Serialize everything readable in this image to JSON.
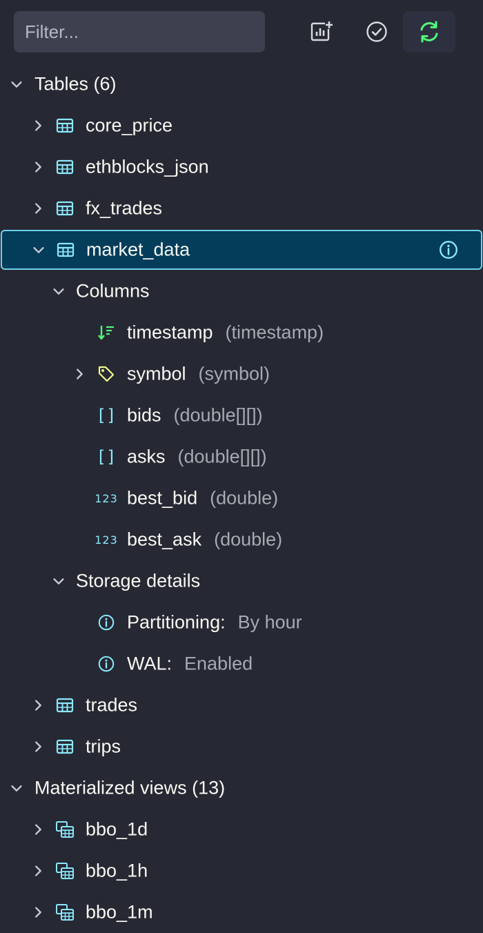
{
  "filter": {
    "placeholder": "Filter..."
  },
  "toolbar": {
    "add_panel_icon": "chart-add-icon",
    "select_icon": "check-circle-icon",
    "refresh_icon": "refresh-icon"
  },
  "colors": {
    "background": "#262833",
    "selected_bg": "#033d5a",
    "selected_border": "#6fd3e9",
    "icon_cyan": "#8be9fd",
    "icon_green": "#50fa7b",
    "icon_yellow": "#f1fa8c",
    "muted_text": "#a7a9b3"
  },
  "tables_section": {
    "label": "Tables (6)",
    "items": [
      {
        "name": "core_price"
      },
      {
        "name": "ethblocks_json"
      },
      {
        "name": "fx_trades"
      },
      {
        "name": "market_data",
        "columns_label": "Columns",
        "columns": [
          {
            "name": "timestamp",
            "type": "(timestamp)",
            "icon": "designated-timestamp-icon"
          },
          {
            "name": "symbol",
            "type": "(symbol)",
            "icon": "tag-icon"
          },
          {
            "name": "bids",
            "type": "(double[][])",
            "icon": "array-icon",
            "glyph": "[]"
          },
          {
            "name": "asks",
            "type": "(double[][])",
            "icon": "array-icon",
            "glyph": "[]"
          },
          {
            "name": "best_bid",
            "type": "(double)",
            "icon": "numeric-icon",
            "glyph": "123"
          },
          {
            "name": "best_ask",
            "type": "(double)",
            "icon": "numeric-icon",
            "glyph": "123"
          }
        ],
        "storage_label": "Storage details",
        "storage": [
          {
            "key": "Partitioning:",
            "value": "By hour"
          },
          {
            "key": "WAL:",
            "value": "Enabled"
          }
        ]
      },
      {
        "name": "trades"
      },
      {
        "name": "trips"
      }
    ]
  },
  "views_section": {
    "label": "Materialized views (13)",
    "items": [
      {
        "name": "bbo_1d"
      },
      {
        "name": "bbo_1h"
      },
      {
        "name": "bbo_1m"
      }
    ]
  }
}
